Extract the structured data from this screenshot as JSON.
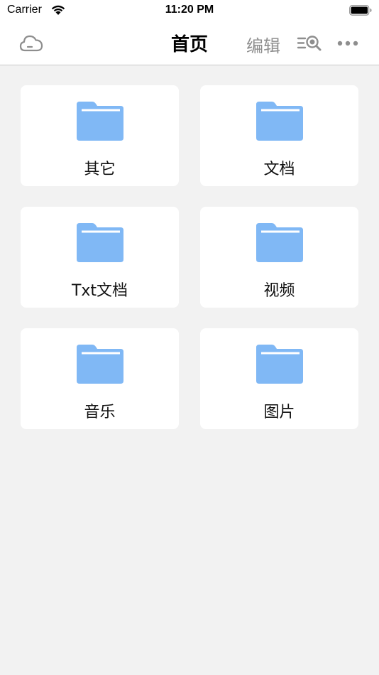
{
  "status_bar": {
    "carrier": "Carrier",
    "time": "11:20 PM"
  },
  "nav": {
    "title": "首页",
    "edit_label": "编辑",
    "left_icon": "cloud-icon",
    "right_icons": [
      "search-list-icon",
      "more-icon"
    ]
  },
  "folders": [
    {
      "label": "其它",
      "icon": "folder-icon"
    },
    {
      "label": "文档",
      "icon": "folder-icon"
    },
    {
      "label": "Txt文档",
      "icon": "folder-icon"
    },
    {
      "label": "视频",
      "icon": "folder-icon"
    },
    {
      "label": "音乐",
      "icon": "folder-icon"
    },
    {
      "label": "图片",
      "icon": "folder-icon"
    }
  ],
  "colors": {
    "background": "#f2f2f2",
    "card": "#ffffff",
    "folder": "#80b8f5",
    "folder_tab_line": "#ffffff",
    "icon_gray": "#8e8e8e"
  }
}
